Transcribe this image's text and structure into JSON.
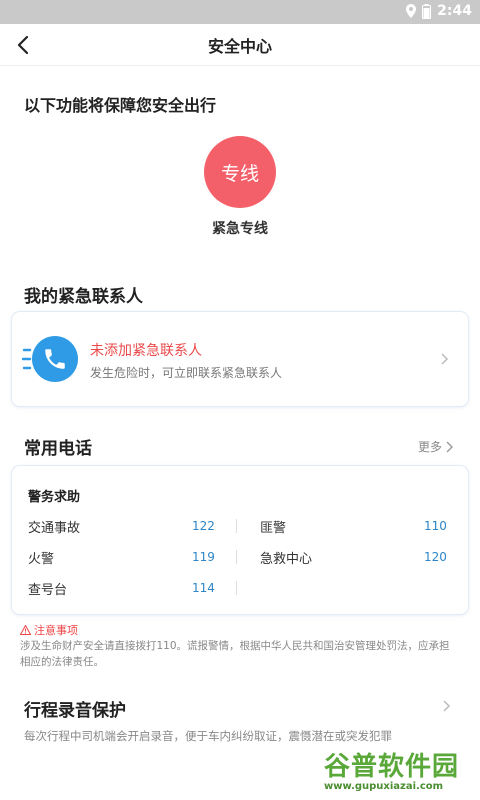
{
  "status_bar": {
    "time": "2:44"
  },
  "navbar": {
    "title": "安全中心"
  },
  "features": {
    "heading": "以下功能将保障您安全出行",
    "hotline_icon_text": "专线",
    "hotline_label": "紧急专线"
  },
  "contacts": {
    "heading": "我的紧急联系人",
    "title": "未添加紧急联系人",
    "desc": "发生危险时，可立即联系紧急联系人"
  },
  "common_phones": {
    "heading": "常用电话",
    "more_label": "更多",
    "category": "警务求助",
    "items": [
      {
        "name": "交通事故",
        "number": "122"
      },
      {
        "name": "匪警",
        "number": "110"
      },
      {
        "name": "火警",
        "number": "119"
      },
      {
        "name": "急救中心",
        "number": "120"
      },
      {
        "name": "查号台",
        "number": "114"
      }
    ]
  },
  "notice": {
    "title": "注意事项",
    "body": "涉及生命财产安全请直接拨打110。谎报警情，根据中华人民共和国治安管理处罚法，应承担相应的法律责任。"
  },
  "record": {
    "heading": "行程录音保护",
    "desc": "每次行程中司机端会开启录音，便于车内纠纷取证，震慑潜在或突发犯罪"
  },
  "watermark": {
    "main": "谷普软件园",
    "sub": "www.gupuxiazai.com"
  },
  "colors": {
    "accent_blue": "#2f9be6",
    "hotline_red": "#f4606a",
    "warning_red": "#ea4a4a",
    "number_blue": "#2e86c8"
  }
}
